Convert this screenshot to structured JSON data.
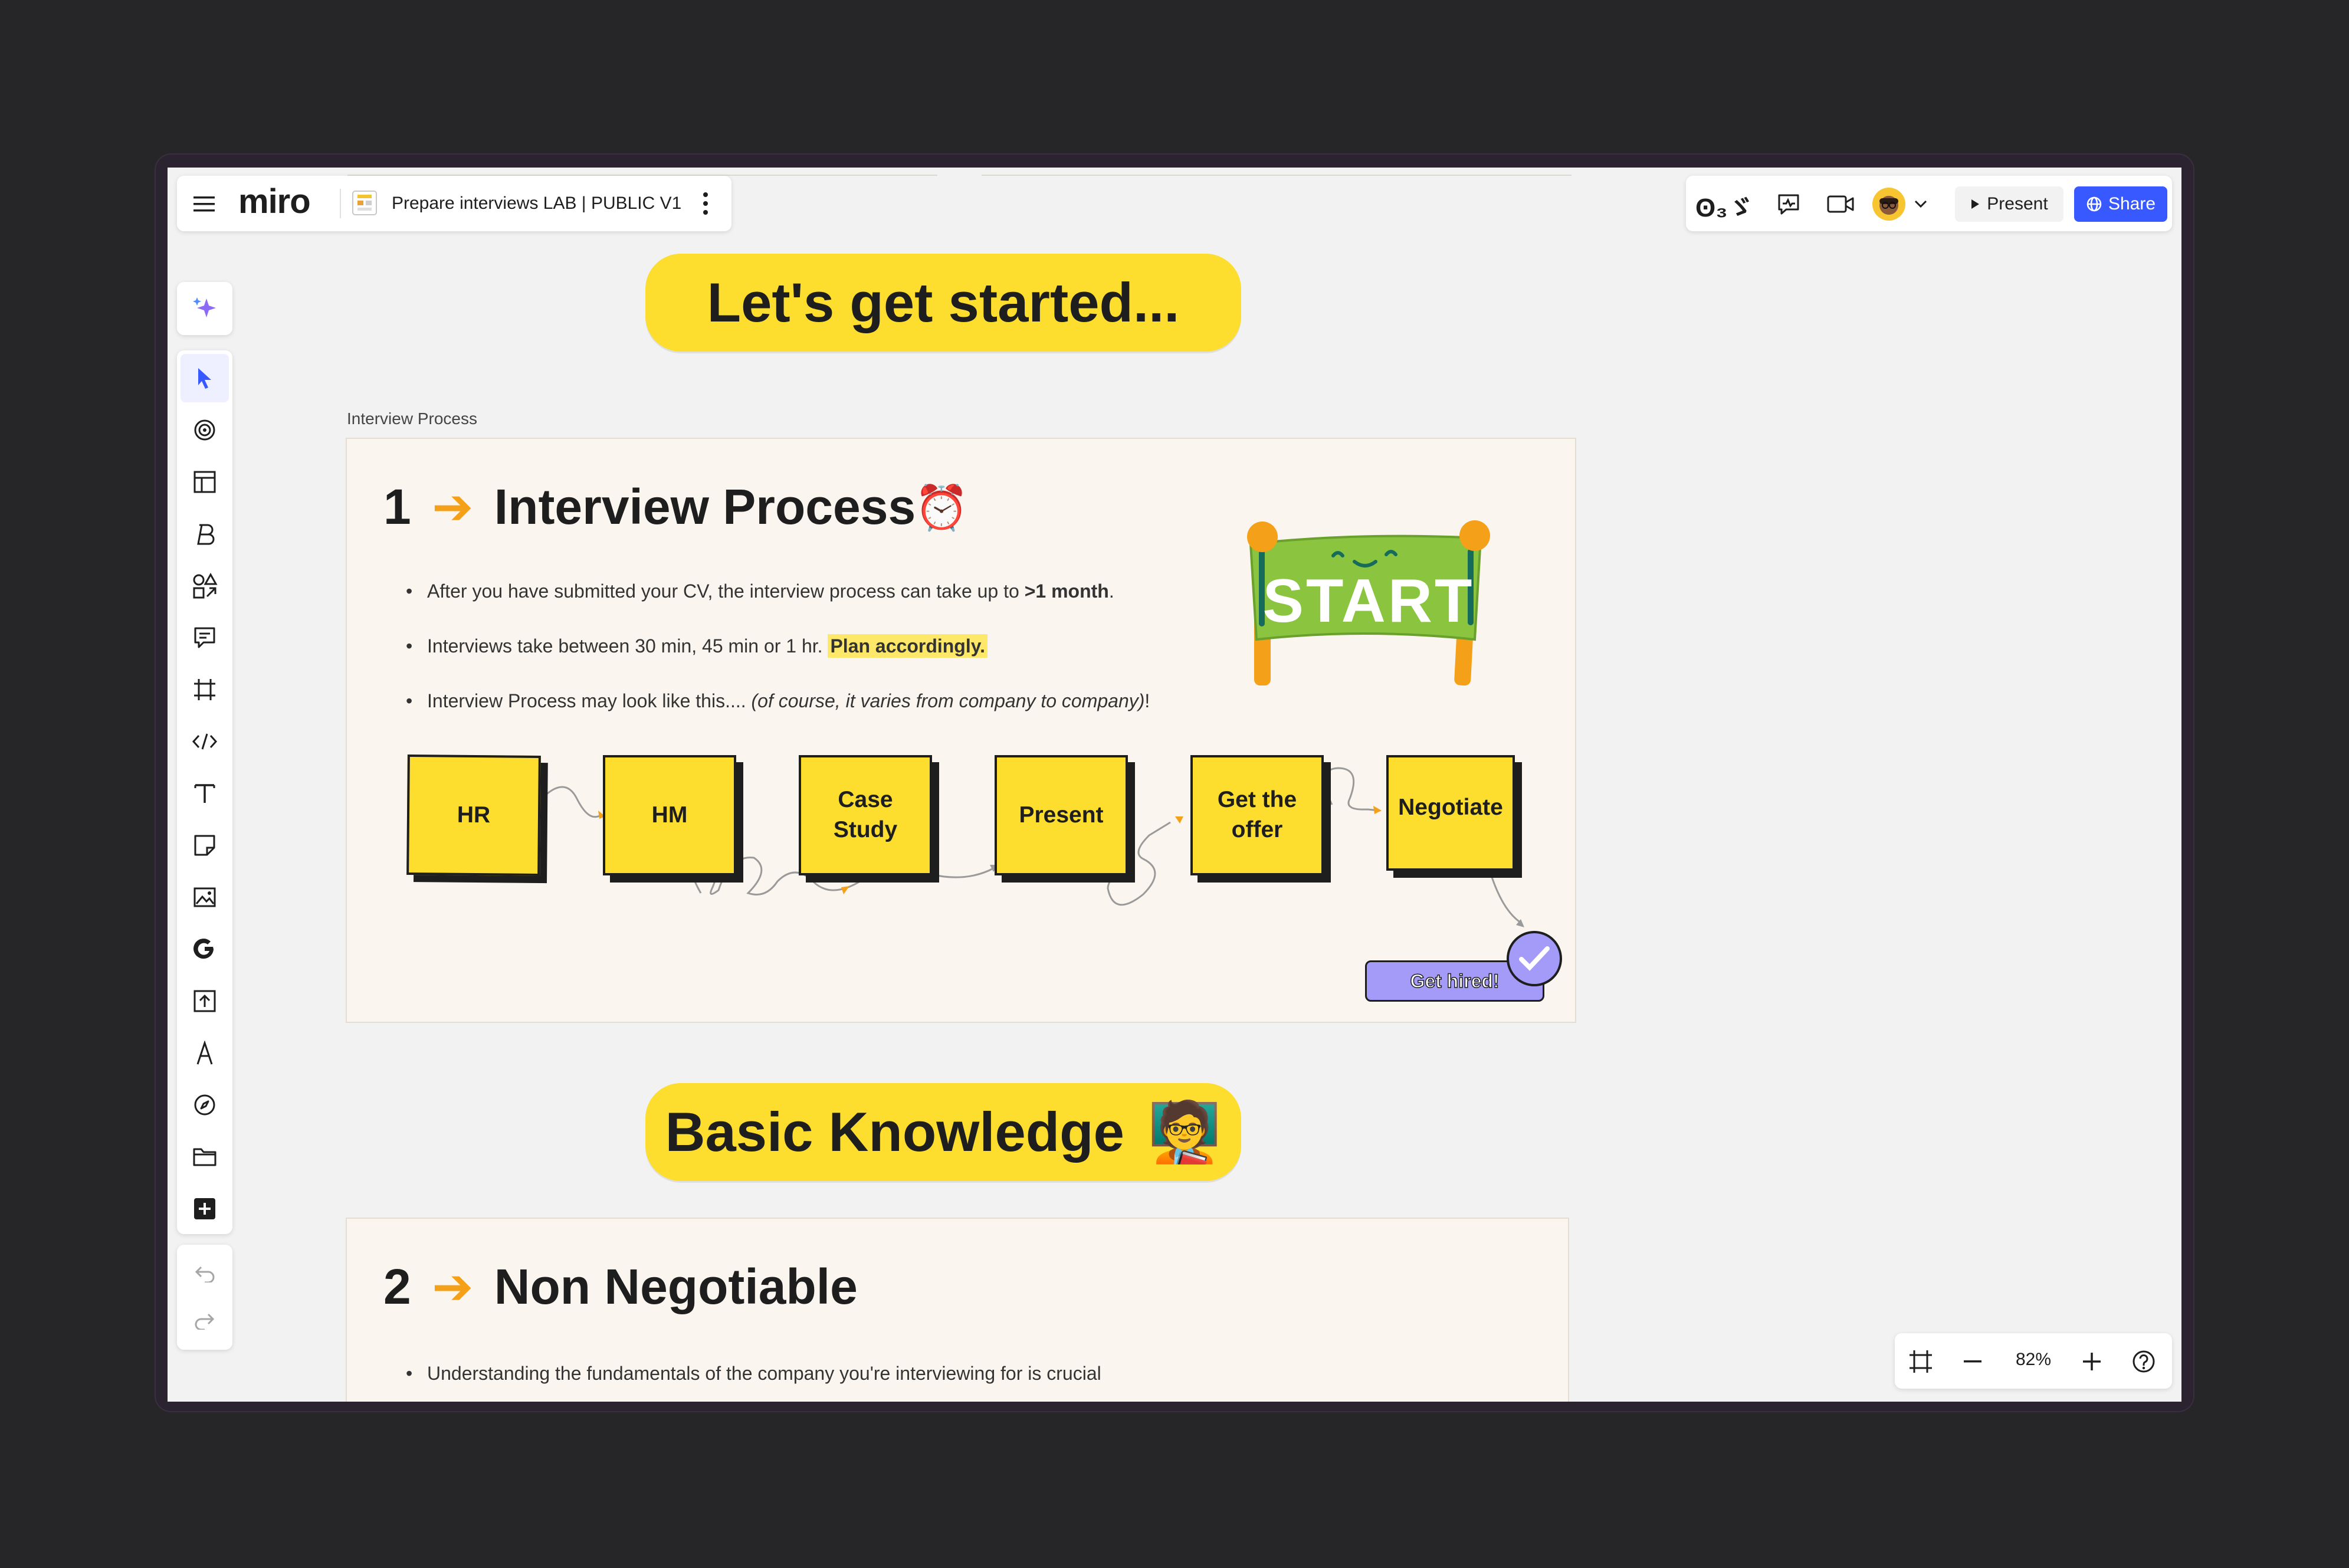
{
  "board": {
    "title": "Prepare interviews LAB | PUBLIC V1",
    "logo_text": "miro"
  },
  "topbar": {
    "reactions_label": "ʘ₃ゞ",
    "present_label": "Present",
    "share_label": "Share"
  },
  "zoom": {
    "level": "82%"
  },
  "canvas": {
    "banner1": "Let's get started...",
    "frame1_label": "Interview Process",
    "section1": {
      "number": "1",
      "arrow": "➔",
      "title": "Interview Process",
      "emoji": "⏰",
      "bullet1_text": "After you have submitted your CV, the interview process can take up to ",
      "bullet1_bold": ">1 month",
      "bullet1_end": ".",
      "bullet2_text": "Interviews take between 30 min, 45 min or 1 hr. ",
      "bullet2_highlight": "Plan accordingly.",
      "bullet3_text": "Interview Process may look like this.... ",
      "bullet3_italic": "(of course, it varies from company to company)",
      "bullet3_end": "!",
      "start_sign": "START",
      "steps": [
        "HR",
        "HM",
        "Case\nStudy",
        "Present",
        "Get the\noffer",
        "Negotiate"
      ],
      "hired_label": "Get hired!"
    },
    "banner2": "Basic Knowledge",
    "banner2_emoji": "🧑‍🏫",
    "section2": {
      "number": "2",
      "arrow": "➔",
      "title": "Non Negotiable",
      "bullet1_text": "Understanding the fundamentals of the company you're interviewing for is crucial"
    }
  },
  "colors": {
    "accent_blue": "#3859ff",
    "sticky_yellow": "#fdde2e",
    "purple": "#a39bf7",
    "orange": "#f4a018",
    "green": "#8bc53f"
  }
}
